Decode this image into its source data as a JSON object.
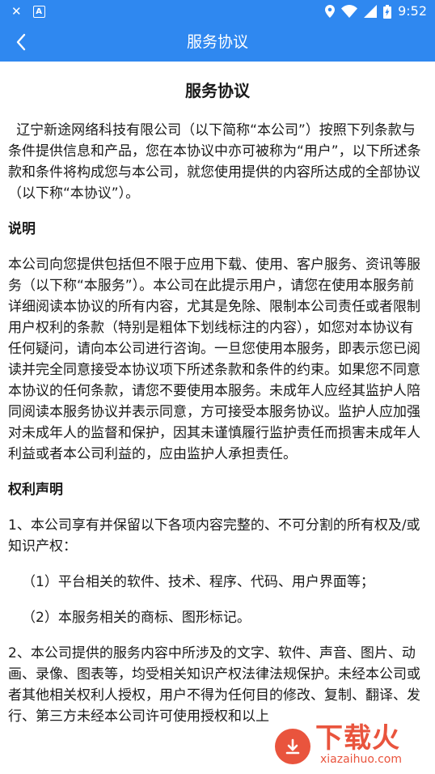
{
  "status_bar": {
    "time": "9:52",
    "left_icons": [
      "close-icon",
      "a-icon"
    ],
    "right_icons": [
      "location-icon",
      "wifi-icon",
      "signal-icon",
      "battery-icon"
    ]
  },
  "app_bar": {
    "title": "服务协议",
    "back_icon": "chevron-left-icon",
    "background": "#2f88f0"
  },
  "document": {
    "title": "服务协议",
    "intro": "辽宁新途网络科技有限公司（以下简称“本公司”）按照下列条款与条件提供信息和产品，您在本协议中亦可被称为“用户”，以下所述条款和条件将构成您与本公司，就您使用提供的内容所达成的全部协议（以下称“本协议”）。",
    "section1_title": "说明",
    "section1_body": "本公司向您提供包括但不限于应用下载、使用、客户服务、资讯等服务（以下称“本服务”）。本公司在此提示用户，请您在使用本服务前详细阅读本协议的所有内容，尤其是免除、限制本公司责任或者限制用户权利的条款（特别是粗体下划线标注的内容），如您对本协议有任何疑问，请向本公司进行咨询。一旦您使用本服务，即表示您已阅读并完全同意接受本协议项下所述条款和条件的约束。如果您不同意本协议的任何条款，请您不要使用本服务。未成年人应经其监护人陪同阅读本服务协议并表示同意，方可接受本服务协议。监护人应加强对未成年人的监督和保护，因其未谨慎履行监护责任而损害未成年人利益或者本公司利益的，应由监护人承担责任。",
    "section2_title": "权利声明",
    "clause1": "1、本公司享有并保留以下各项内容完整的、不可分割的所有权及/或知识产权：",
    "clause1_item1": "（1）平台相关的软件、技术、程序、代码、用户界面等；",
    "clause1_item2": "（2）本服务相关的商标、图形标记。",
    "clause2": "2、本公司提供的服务内容中所涉及的文字、软件、声音、图片、动画、录像、图表等，均受相关知识产权法律法规保护。未经本公司或者其他相关权利人授权，用户不得为任何目的修改、复制、翻译、发行、第三方未经本公司许可使用授权和以上"
  },
  "watermark": {
    "text": "下载火",
    "url": "xiazaihuo.com",
    "color": "#e8462d"
  }
}
